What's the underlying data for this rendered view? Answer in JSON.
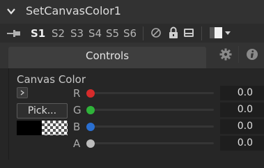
{
  "window": {
    "title": "SetCanvasColor1"
  },
  "toolbar": {
    "slots": [
      "S1",
      "S2",
      "S3",
      "S4",
      "S5",
      "S6"
    ],
    "active_slot": "S1"
  },
  "tabs": {
    "controls_label": "Controls"
  },
  "canvas_color": {
    "label": "Canvas Color",
    "pick_label": "Pick...",
    "channels": [
      {
        "name": "R",
        "value": "0.0",
        "color": "#d62b2b"
      },
      {
        "name": "G",
        "value": "0.0",
        "color": "#2fb33a"
      },
      {
        "name": "B",
        "value": "0.0",
        "color": "#2a6fd0"
      },
      {
        "name": "A",
        "value": "0.0",
        "color": "#bdbdbd"
      }
    ]
  },
  "colors": {
    "background": "#282828",
    "active_tab": "#3e3e3e"
  }
}
